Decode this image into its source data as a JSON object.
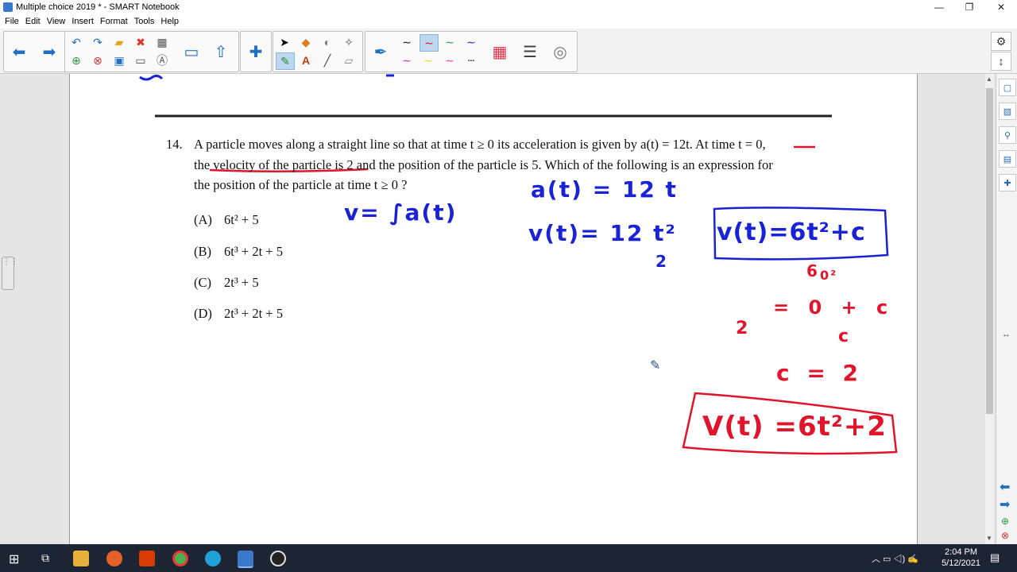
{
  "window": {
    "title": "Multiple choice 2019 * - SMART Notebook",
    "minimize": "—",
    "maximize": "❐",
    "close": "✕"
  },
  "menu": [
    "File",
    "Edit",
    "View",
    "Insert",
    "Format",
    "Tools",
    "Help"
  ],
  "toolbar_icons": [
    "back-arrow",
    "forward-arrow",
    "undo",
    "redo",
    "open-folder",
    "delete",
    "add-page",
    "delete-page",
    "save",
    "table",
    "screen-shade",
    "text-recognition",
    "display",
    "share",
    "add-in",
    "select",
    "shapes",
    "pen-eraser",
    "magic-pen",
    "creative-pen",
    "text",
    "line",
    "eraser",
    "pen",
    "pen-colors",
    "fill",
    "properties",
    "more"
  ],
  "question": {
    "number": "14.",
    "line1": "A particle moves along a straight line so that at time t ≥ 0 its acceleration is given by a(t) = 12t. At time t = 0,",
    "line2": "the velocity of the particle is 2 and the position of the particle is 5. Which of the following is an expression for",
    "line3": "the position of the particle at time t ≥ 0 ?",
    "options": [
      {
        "label": "(A)",
        "text": "6t² + 5"
      },
      {
        "label": "(B)",
        "text": "6t³ + 2t + 5"
      },
      {
        "label": "(C)",
        "text": "2t³ + 5"
      },
      {
        "label": "(D)",
        "text": "2t³ + 2t + 5"
      }
    ]
  },
  "handwriting": {
    "blue": [
      "v= ∫a(t)",
      "a(t) = 12 t",
      "v(t)= 12 t²",
      "2",
      "v(t)=6t²+c"
    ],
    "red": [
      "6",
      "0²",
      "2",
      "= 0 + c",
      "c",
      "c = 2",
      "V(t) =6t²+2"
    ]
  },
  "colors": {
    "ink_blue": "#1a22d6",
    "ink_red": "#e0142a",
    "taskbar": "#1d2433"
  },
  "taskbar": {
    "time": "2:04 PM",
    "date": "5/12/2021"
  }
}
